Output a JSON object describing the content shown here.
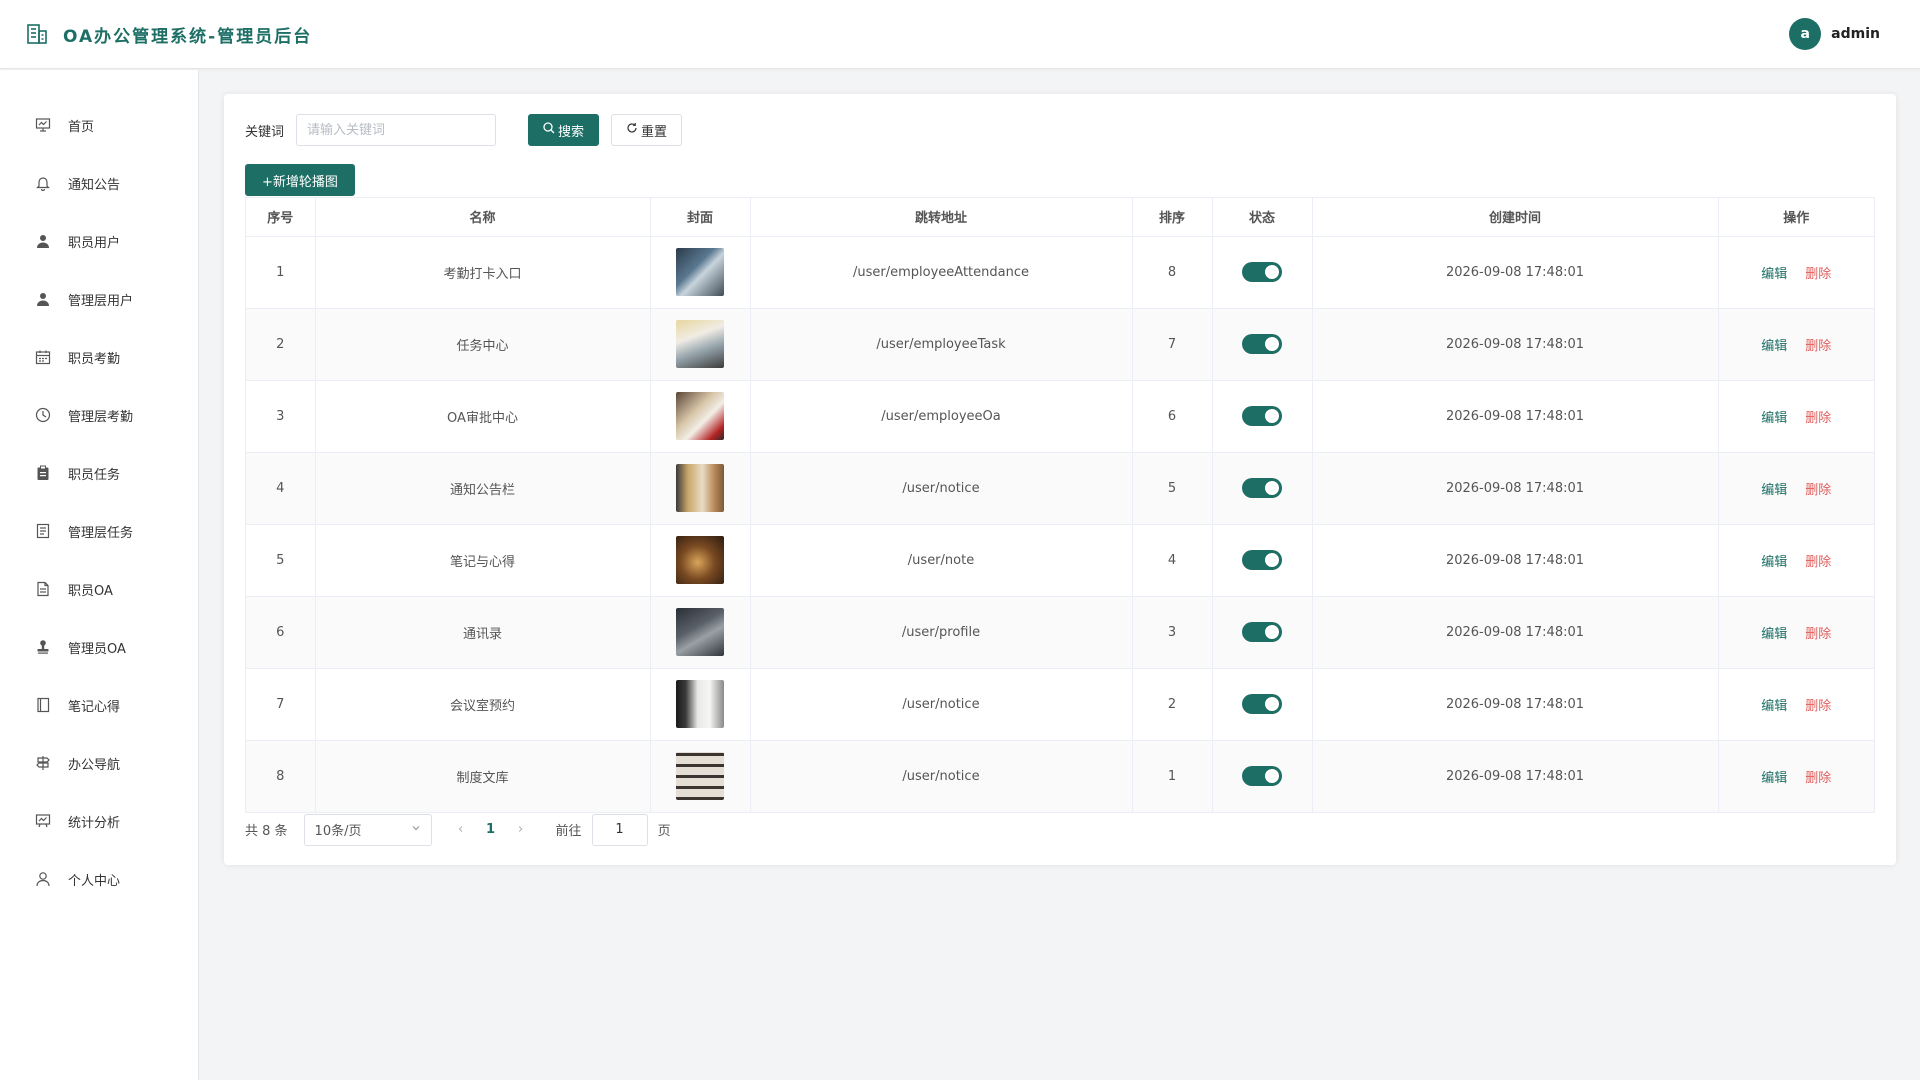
{
  "header": {
    "title": "OA办公管理系统-管理员后台",
    "user_initial": "a",
    "user_name": "admin",
    "brand_color": "#1d6f66"
  },
  "sidebar": {
    "items": [
      {
        "label": "首页",
        "icon": "dashboard-icon"
      },
      {
        "label": "通知公告",
        "icon": "bell-icon"
      },
      {
        "label": "职员用户",
        "icon": "user-icon"
      },
      {
        "label": "管理层用户",
        "icon": "user-icon"
      },
      {
        "label": "职员考勤",
        "icon": "calendar-icon"
      },
      {
        "label": "管理层考勤",
        "icon": "clock-icon"
      },
      {
        "label": "职员任务",
        "icon": "clipboard-icon"
      },
      {
        "label": "管理层任务",
        "icon": "document-icon"
      },
      {
        "label": "职员OA",
        "icon": "file-icon"
      },
      {
        "label": "管理员OA",
        "icon": "stamp-icon"
      },
      {
        "label": "笔记心得",
        "icon": "notebook-icon"
      },
      {
        "label": "办公导航",
        "icon": "signpost-icon"
      },
      {
        "label": "统计分析",
        "icon": "chart-icon"
      },
      {
        "label": "个人中心",
        "icon": "person-icon"
      }
    ]
  },
  "search": {
    "label": "关键词",
    "placeholder": "请输入关键词",
    "search_label": "搜索",
    "reset_label": "重置"
  },
  "toolbar": {
    "add_label": "+新增轮播图"
  },
  "table": {
    "columns": [
      "序号",
      "名称",
      "封面",
      "跳转地址",
      "排序",
      "状态",
      "创建时间",
      "操作"
    ],
    "edit_label": "编辑",
    "delete_label": "删除",
    "rows": [
      {
        "index": "1",
        "name": "考勤打卡入口",
        "url": "/user/employeeAttendance",
        "order": "8",
        "enabled": true,
        "created": "2026-09-08 17:48:01",
        "cover": "office-person-thumb"
      },
      {
        "index": "2",
        "name": "任务中心",
        "url": "/user/employeeTask",
        "order": "7",
        "enabled": true,
        "created": "2026-09-08 17:48:01",
        "cover": "task-board-thumb"
      },
      {
        "index": "3",
        "name": "OA审批中心",
        "url": "/user/employeeOa",
        "order": "6",
        "enabled": true,
        "created": "2026-09-08 17:48:01",
        "cover": "papers-stamp-thumb"
      },
      {
        "index": "4",
        "name": "通知公告栏",
        "url": "/user/notice",
        "order": "5",
        "enabled": true,
        "created": "2026-09-08 17:48:01",
        "cover": "bulletin-board-thumb"
      },
      {
        "index": "5",
        "name": "笔记与心得",
        "url": "/user/note",
        "order": "4",
        "enabled": true,
        "created": "2026-09-08 17:48:01",
        "cover": "notebook-thumb"
      },
      {
        "index": "6",
        "name": "通讯录",
        "url": "/user/profile",
        "order": "3",
        "enabled": true,
        "created": "2026-09-08 17:48:01",
        "cover": "desk-laptop-thumb"
      },
      {
        "index": "7",
        "name": "会议室预约",
        "url": "/user/notice",
        "order": "2",
        "enabled": true,
        "created": "2026-09-08 17:48:01",
        "cover": "meeting-room-thumb"
      },
      {
        "index": "8",
        "name": "制度文库",
        "url": "/user/notice",
        "order": "1",
        "enabled": true,
        "created": "2026-09-08 17:48:01",
        "cover": "archive-shelf-thumb"
      }
    ]
  },
  "pagination": {
    "total": "共 8 条",
    "page_size": "10条/页",
    "current_page": "1",
    "goto_label": "前往",
    "goto_value": "1",
    "goto_suffix": "页"
  }
}
